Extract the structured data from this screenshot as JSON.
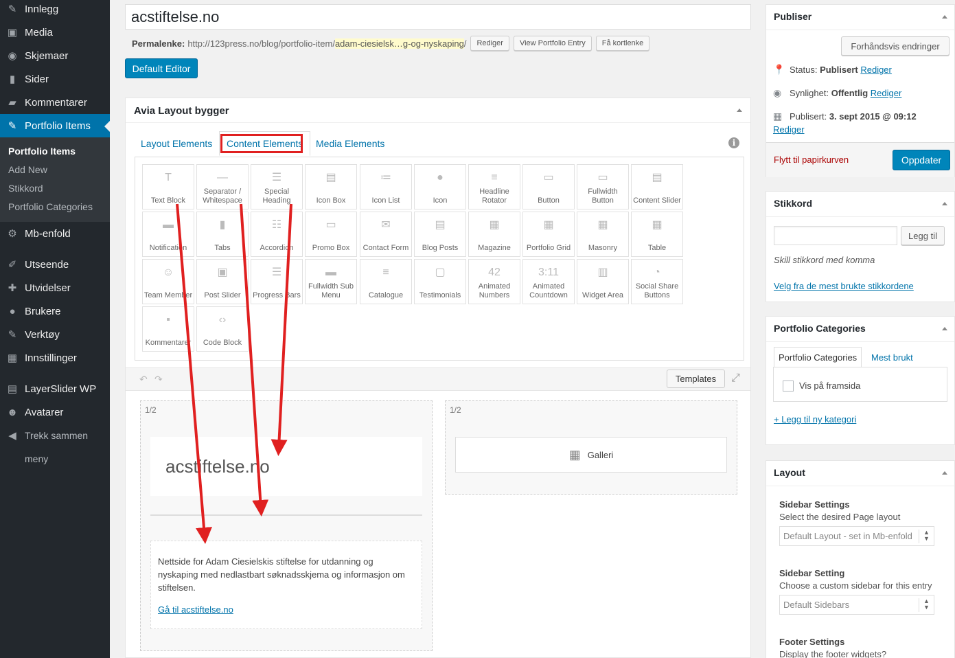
{
  "sidebar": {
    "items": [
      {
        "label": "Innlegg",
        "icon": "pin-icon"
      },
      {
        "label": "Media",
        "icon": "media-icon"
      },
      {
        "label": "Skjemaer",
        "icon": "forms-icon"
      },
      {
        "label": "Sider",
        "icon": "pages-icon"
      },
      {
        "label": "Kommentarer",
        "icon": "comments-icon"
      },
      {
        "label": "Portfolio Items",
        "icon": "pin-icon"
      },
      {
        "label": "Mb-enfold",
        "icon": "gear-icon"
      },
      {
        "label": "Utseende",
        "icon": "brush-icon"
      },
      {
        "label": "Utvidelser",
        "icon": "plugin-icon"
      },
      {
        "label": "Brukere",
        "icon": "user-icon"
      },
      {
        "label": "Verktøy",
        "icon": "wrench-icon"
      },
      {
        "label": "Innstillinger",
        "icon": "settings-icon"
      },
      {
        "label": "LayerSlider WP",
        "icon": "layers-icon"
      },
      {
        "label": "Avatarer",
        "icon": "avatar-icon"
      },
      {
        "label": "Trekk sammen",
        "icon": "collapse-icon"
      },
      {
        "label": "meny",
        "icon": ""
      }
    ],
    "submenu": [
      "Portfolio Items",
      "Add New",
      "Stikkord",
      "Portfolio Categories"
    ]
  },
  "editor": {
    "title": "acstiftelse.no",
    "permalink_label": "Permalenke:",
    "permalink_base": "http://123press.no/blog/portfolio-item/",
    "permalink_slug": "adam-ciesielsk…g-og-nyskaping",
    "permalink_end": "/",
    "edit_btn": "Rediger",
    "view_btn": "View Portfolio Entry",
    "shortlink_btn": "Få kortlenke",
    "default_editor_btn": "Default Editor"
  },
  "builder": {
    "title": "Avia Layout bygger",
    "tabs": [
      "Layout Elements",
      "Content Elements",
      "Media Elements"
    ],
    "info": "i",
    "elements": [
      {
        "label": "Text Block",
        "icon": "T"
      },
      {
        "label": "Separator / Whitespace",
        "icon": "—"
      },
      {
        "label": "Special Heading",
        "icon": "☰"
      },
      {
        "label": "Icon Box",
        "icon": "▤"
      },
      {
        "label": "Icon List",
        "icon": "≔"
      },
      {
        "label": "Icon",
        "icon": "●"
      },
      {
        "label": "Headline Rotator",
        "icon": "≡"
      },
      {
        "label": "Button",
        "icon": "▭"
      },
      {
        "label": "Fullwidth Button",
        "icon": "▭"
      },
      {
        "label": "Content Slider",
        "icon": "▤"
      },
      {
        "label": "Notification",
        "icon": "▬"
      },
      {
        "label": "Tabs",
        "icon": "▮"
      },
      {
        "label": "Accordion",
        "icon": "☷"
      },
      {
        "label": "Promo Box",
        "icon": "▭"
      },
      {
        "label": "Contact Form",
        "icon": "✉"
      },
      {
        "label": "Blog Posts",
        "icon": "▤"
      },
      {
        "label": "Magazine",
        "icon": "▦"
      },
      {
        "label": "Portfolio Grid",
        "icon": "▦"
      },
      {
        "label": "Masonry",
        "icon": "▦"
      },
      {
        "label": "Table",
        "icon": "▦"
      },
      {
        "label": "Team Member",
        "icon": "☺"
      },
      {
        "label": "Post Slider",
        "icon": "▣"
      },
      {
        "label": "Progress Bars",
        "icon": "☰"
      },
      {
        "label": "Fullwidth Sub Menu",
        "icon": "▬"
      },
      {
        "label": "Catalogue",
        "icon": "≡"
      },
      {
        "label": "Testimonials",
        "icon": "▢"
      },
      {
        "label": "Animated Numbers",
        "icon": "42"
      },
      {
        "label": "Animated Countdown",
        "icon": "3:11"
      },
      {
        "label": "Widget Area",
        "icon": "▥"
      },
      {
        "label": "Social Share Buttons",
        "icon": "◔"
      },
      {
        "label": "Kommentarer",
        "icon": "▪"
      },
      {
        "label": "Code Block",
        "icon": "‹›"
      }
    ],
    "undo": "↶",
    "redo": "↷",
    "templates_btn": "Templates",
    "col_left_label": "1/2",
    "col_right_label": "1/2",
    "heading_text": "acstiftelse.no",
    "text_block": "Nettside for Adam Ciesielskis stiftelse for utdanning og nyskaping med nedlastbart søknadsskjema og informasjon om stiftelsen.",
    "text_link": "Gå til acstiftelse.no",
    "gallery_label": "Galleri"
  },
  "publish": {
    "title": "Publiser",
    "preview_btn": "Forhåndsvis endringer",
    "status_label": "Status:",
    "status_value": "Publisert",
    "visibility_label": "Synlighet:",
    "visibility_value": "Offentlig",
    "published_label": "Publisert:",
    "published_value": "3. sept 2015 @ 09:12",
    "edit_link": "Rediger",
    "trash_link": "Flytt til papirkurven",
    "update_btn": "Oppdater"
  },
  "tags": {
    "title": "Stikkord",
    "add_btn": "Legg til",
    "hint": "Skill stikkord med komma",
    "choose_link": "Velg fra de mest brukte stikkordene"
  },
  "categories": {
    "title": "Portfolio Categories",
    "tab_all": "Portfolio Categories",
    "tab_most_used": "Mest brukt",
    "item": "Vis på framsida",
    "add_link": "+ Legg til ny kategori"
  },
  "layout": {
    "title": "Layout",
    "sidebar_settings_label": "Sidebar Settings",
    "sidebar_settings_desc": "Select the desired Page layout",
    "sidebar_settings_value": "Default Layout - set in Mb-enfold",
    "sidebar_setting_label": "Sidebar Setting",
    "sidebar_setting_desc": "Choose a custom sidebar for this entry",
    "sidebar_setting_value": "Default Sidebars",
    "footer_label": "Footer Settings",
    "footer_desc": "Display the footer widgets?"
  },
  "colors": {
    "sidebar_bg": "#23282d",
    "accent": "#0073aa",
    "primary_button": "#0085ba",
    "annotation_red": "#e02020"
  }
}
